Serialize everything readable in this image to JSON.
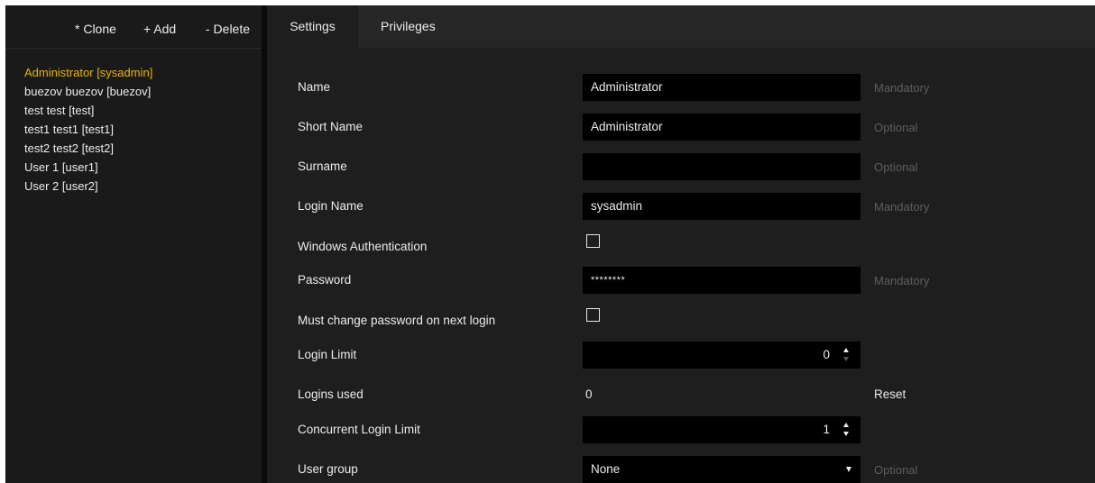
{
  "toolbar": {
    "clone_label": "* Clone",
    "add_label": "+ Add",
    "delete_label": "- Delete"
  },
  "users": [
    {
      "label": "Administrator [sysadmin]",
      "selected": true
    },
    {
      "label": "buezov buezov [buezov]"
    },
    {
      "label": "test test [test]"
    },
    {
      "label": "test1 test1 [test1]"
    },
    {
      "label": "test2 test2 [test2]"
    },
    {
      "label": "User 1 [user1]"
    },
    {
      "label": "User 2 [user2]"
    }
  ],
  "tabs": {
    "settings": "Settings",
    "privileges": "Privileges"
  },
  "form": {
    "name": {
      "label": "Name",
      "value": "Administrator",
      "hint": "Mandatory"
    },
    "short_name": {
      "label": "Short Name",
      "value": "Administrator",
      "hint": "Optional"
    },
    "surname": {
      "label": "Surname",
      "value": "",
      "hint": "Optional"
    },
    "login_name": {
      "label": "Login Name",
      "value": "sysadmin",
      "hint": "Mandatory"
    },
    "windows_auth": {
      "label": "Windows Authentication",
      "checked": false
    },
    "password": {
      "label": "Password",
      "value": "********",
      "hint": "Mandatory"
    },
    "must_change": {
      "label": "Must change password on next login",
      "checked": false
    },
    "login_limit": {
      "label": "Login Limit",
      "value": "0"
    },
    "logins_used": {
      "label": "Logins used",
      "value": "0",
      "reset_label": "Reset"
    },
    "concurrent_limit": {
      "label": "Concurrent Login Limit",
      "value": "1"
    },
    "user_group": {
      "label": "User group",
      "value": "None",
      "hint": "Optional"
    }
  },
  "colors": {
    "selected_user": "#e8b400",
    "hint": "#5e5e5e",
    "background": "#1e1e1e"
  }
}
